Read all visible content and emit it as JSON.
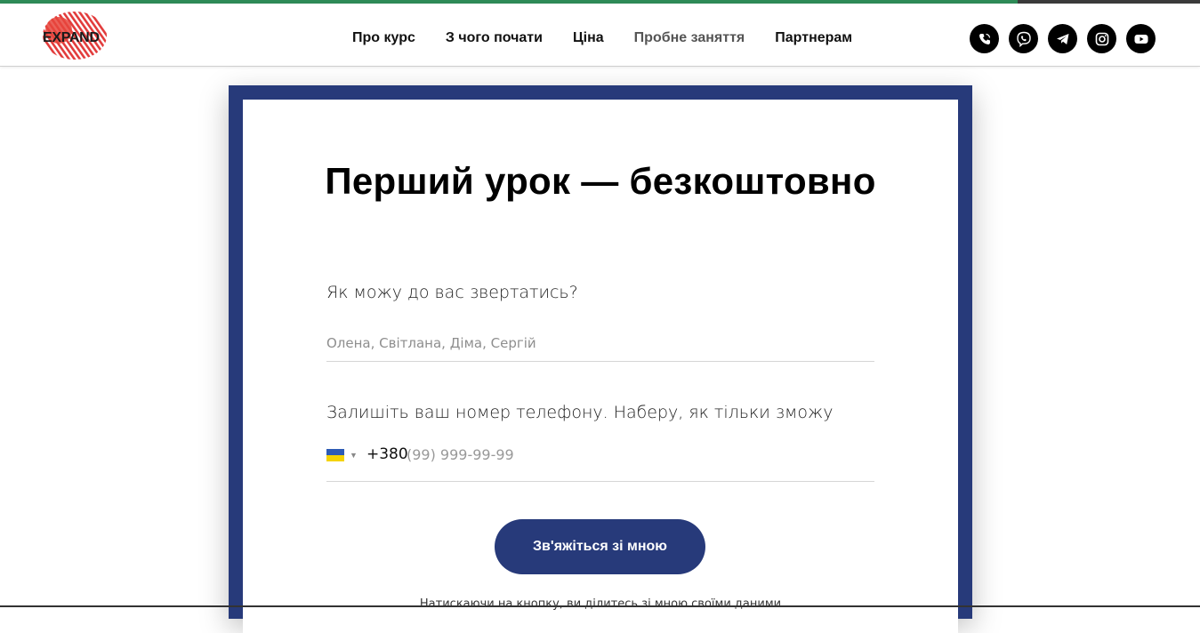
{
  "page": {
    "scroll_progress": 0.848,
    "progress_color": "#2e8b57"
  },
  "header": {
    "logo_text": "EXPAND",
    "nav": [
      {
        "label": "Про курс",
        "active": false
      },
      {
        "label": "З чого почати",
        "active": false
      },
      {
        "label": "Ціна",
        "active": false
      },
      {
        "label": "Пробне заняття",
        "active": true
      },
      {
        "label": "Партнерам",
        "active": false
      }
    ],
    "socials": [
      "phone-icon",
      "viber-icon",
      "telegram-icon",
      "instagram-icon",
      "youtube-icon"
    ]
  },
  "form": {
    "accent_color": "#273a7a",
    "title": "Перший урок — безкоштовно",
    "name_label": "Як можу до вас звертатись?",
    "name_placeholder": "Олена, Світлана, Діма, Сергій",
    "phone_label": "Залишіть ваш номер телефону. Наберу, як тільки зможу",
    "phone_code": "+380",
    "phone_placeholder": "(99) 999-99-99",
    "phone_country": "ukraine-flag-icon",
    "submit_label": "Зв'яжіться зі мною",
    "disclaimer": "Натискаючи на кнопку, ви ділитесь зі мною своїми даними"
  }
}
